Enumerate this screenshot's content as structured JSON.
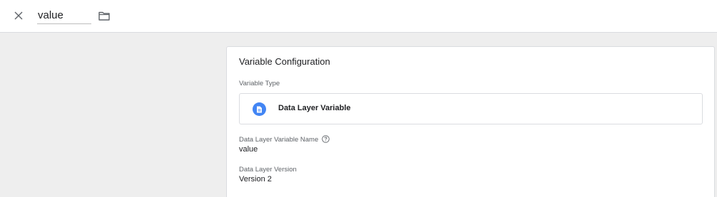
{
  "header": {
    "close_icon": "close-icon",
    "name_value": "value",
    "folder_icon": "folder-icon"
  },
  "config": {
    "title": "Variable Configuration",
    "type_label": "Variable Type",
    "type_value": "Data Layer Variable",
    "type_icon": "document-icon",
    "type_icon_color": "#4285f4",
    "name_label": "Data Layer Variable Name",
    "help_icon": "help-icon",
    "name_value": "value",
    "version_label": "Data Layer Version",
    "version_value": "Version 2"
  }
}
